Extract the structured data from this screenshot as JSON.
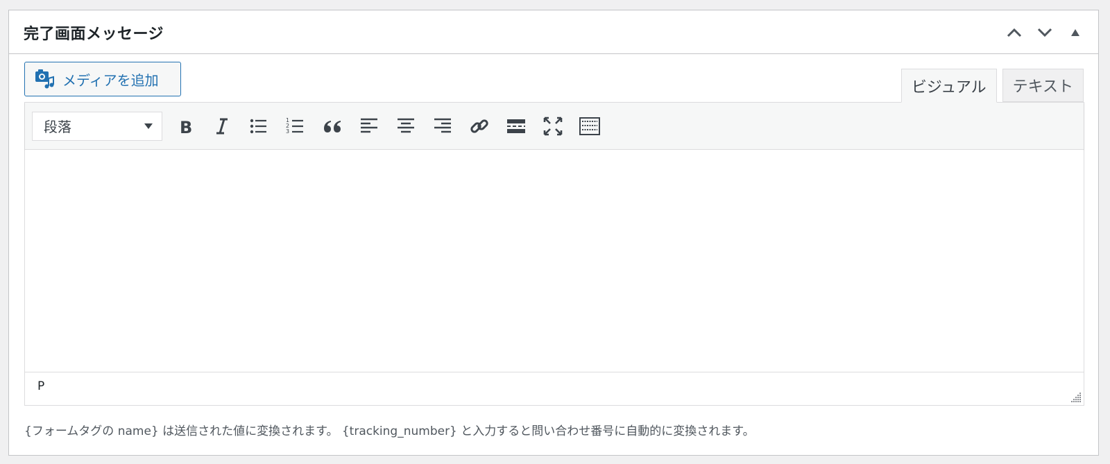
{
  "panel": {
    "title": "完了画面メッセージ",
    "move_up_label": "上へ移動",
    "move_down_label": "下へ移動",
    "toggle_label": "パネルを切り替え"
  },
  "media_button": {
    "label": "メディアを追加",
    "icon": "media-add-icon"
  },
  "tabs": [
    {
      "label": "ビジュアル",
      "active": true
    },
    {
      "label": "テキスト",
      "active": false
    }
  ],
  "toolbar": {
    "format_select": {
      "value": "段落"
    },
    "buttons": [
      {
        "name": "bold-icon"
      },
      {
        "name": "italic-icon"
      },
      {
        "name": "bulleted-list-icon"
      },
      {
        "name": "numbered-list-icon"
      },
      {
        "name": "blockquote-icon"
      },
      {
        "name": "align-left-icon"
      },
      {
        "name": "align-center-icon"
      },
      {
        "name": "align-right-icon"
      },
      {
        "name": "link-icon"
      },
      {
        "name": "read-more-icon"
      },
      {
        "name": "fullscreen-icon"
      },
      {
        "name": "toolbar-toggle-icon"
      }
    ]
  },
  "editor": {
    "content": "",
    "status_path": "P"
  },
  "description": "{フォームタグの name} は送信された値に変換されます。 {tracking_number} と入力すると問い合わせ番号に自動的に変換されます。",
  "colors": {
    "accent": "#2271b1",
    "icon": "#3c434a",
    "border": "#dcdcde",
    "toolbar_bg": "#f6f7f7"
  }
}
